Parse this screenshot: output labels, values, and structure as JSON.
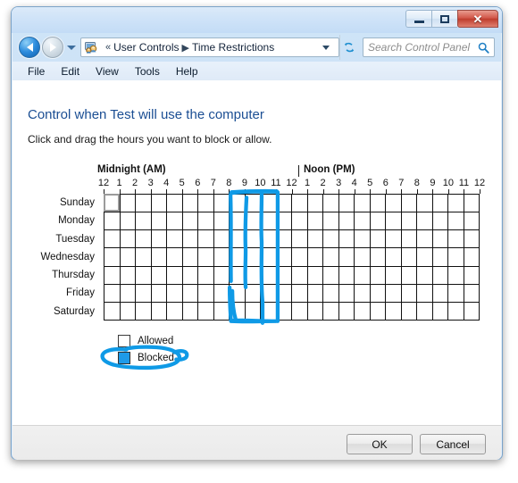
{
  "window": {
    "controls": {
      "minimize": "minimize-button",
      "maximize": "maximize-button",
      "close_glyph": "✕"
    }
  },
  "navbar": {
    "back_tooltip": "Back",
    "forward_tooltip": "Forward",
    "breadcrumb": {
      "prefix": "«",
      "items": [
        "User Controls",
        "Time Restrictions"
      ],
      "separator": "▶"
    },
    "refresh_glyph": "↻"
  },
  "search": {
    "placeholder": "Search Control Panel",
    "icon": "search-icon"
  },
  "menu": {
    "items": [
      "File",
      "Edit",
      "View",
      "Tools",
      "Help"
    ]
  },
  "page": {
    "title": "Control when Test will use the computer",
    "subtitle": "Click and drag the hours you want to block or allow."
  },
  "schedule": {
    "midnight_label": "Midnight (AM)",
    "noon_label": "Noon (PM)",
    "hours": [
      "12",
      "1",
      "2",
      "3",
      "4",
      "5",
      "6",
      "7",
      "8",
      "9",
      "10",
      "11",
      "12",
      "1",
      "2",
      "3",
      "4",
      "5",
      "6",
      "7",
      "8",
      "9",
      "10",
      "11",
      "12"
    ],
    "days": [
      "Sunday",
      "Monday",
      "Tuesday",
      "Wednesday",
      "Thursday",
      "Friday",
      "Saturday"
    ],
    "columns": 24,
    "blocked_cells": [],
    "focused_cell": {
      "day": "Sunday",
      "hour": "12"
    }
  },
  "legend": {
    "allowed_label": "Allowed",
    "blocked_label": "Blocked",
    "allowed_color": "#ffffff",
    "blocked_color": "#1e9ae8"
  },
  "annotations": {
    "ink_color": "#0f9ae6",
    "grid_bracket": "hand-drawn rectangle over hours 9 through 12 spanning all days",
    "legend_circle": "hand-drawn ellipse around Blocked legend entry"
  },
  "footer": {
    "ok_label": "OK",
    "cancel_label": "Cancel"
  }
}
